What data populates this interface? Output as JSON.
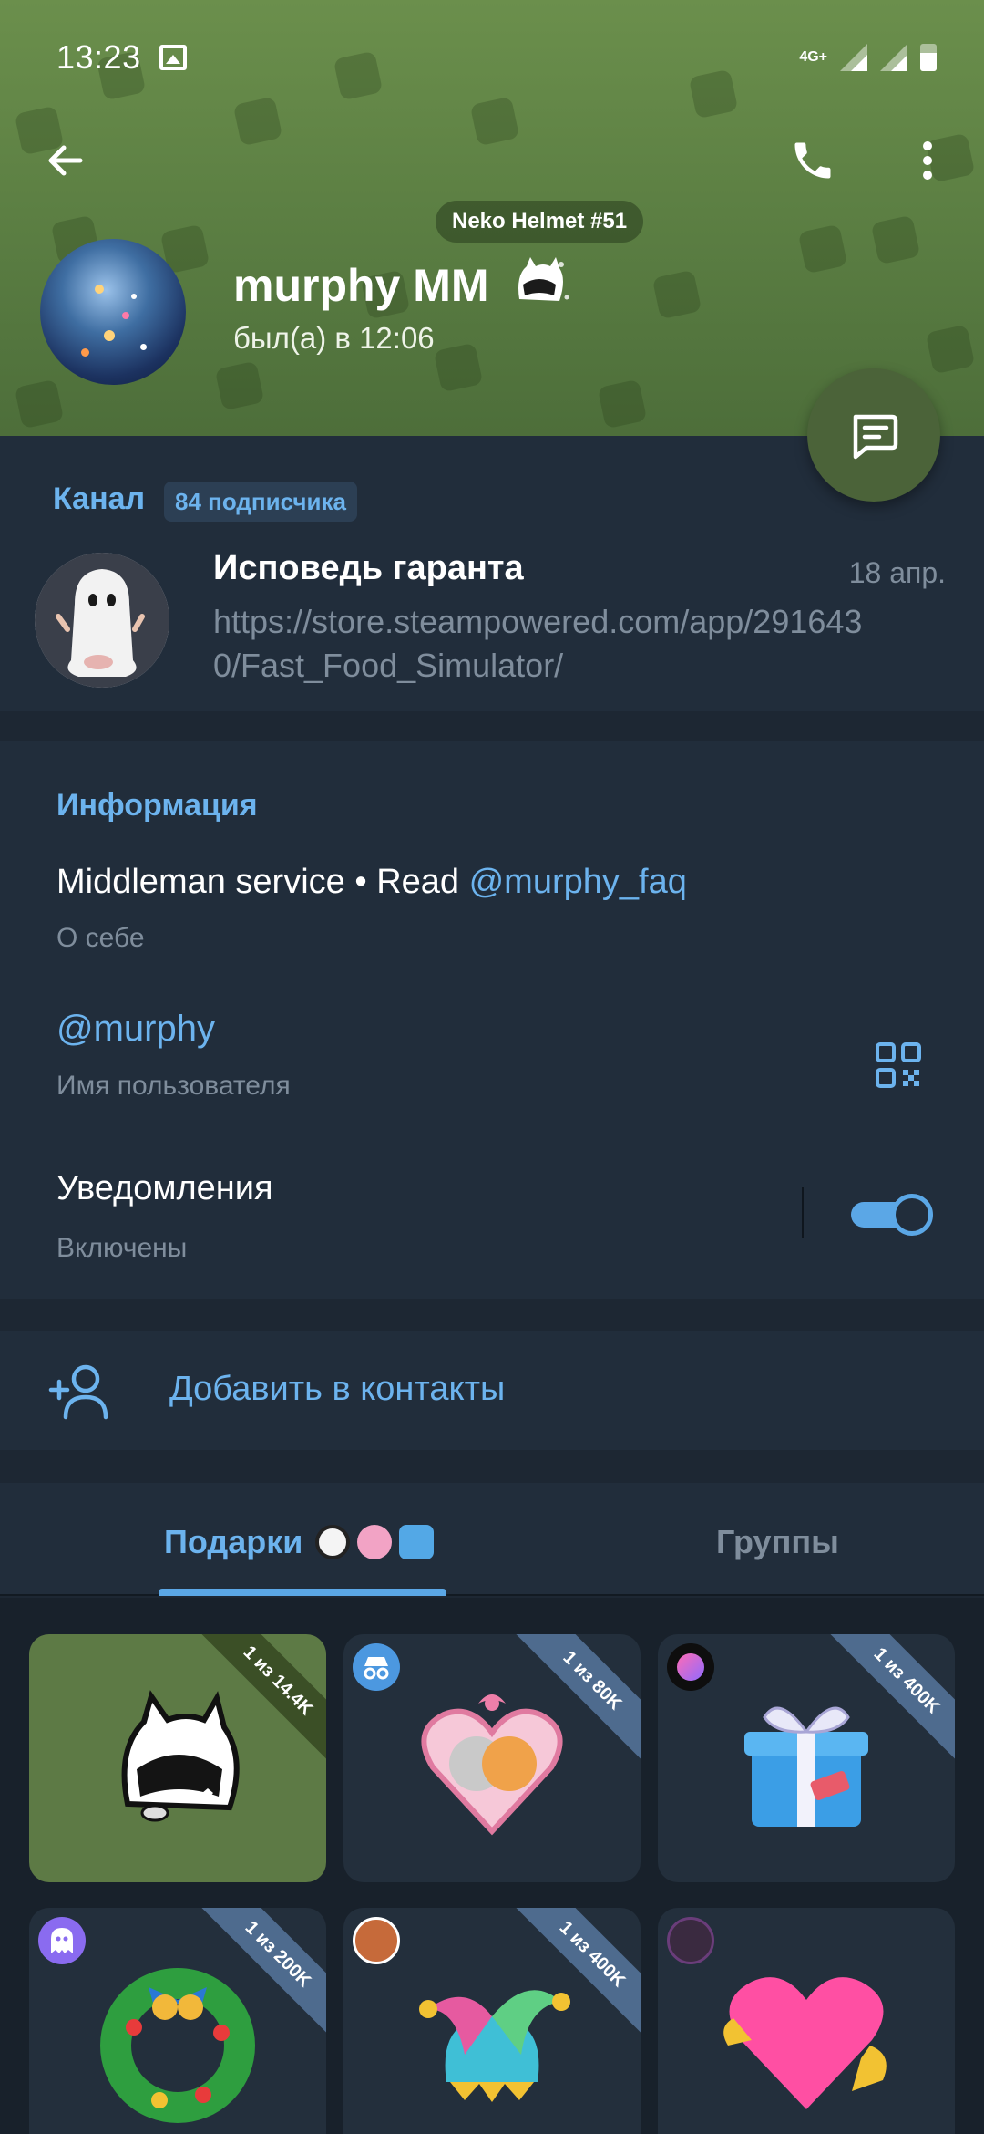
{
  "status_bar": {
    "time": "13:23",
    "network": "4G+"
  },
  "profile": {
    "collectible": "Neko Helmet #51",
    "name": "murphy MM",
    "last_seen": "был(а) в 12:06"
  },
  "channel": {
    "section_label": "Канал",
    "subscribers": "84 подписчика",
    "title": "Исповедь гаранта",
    "date": "18 апр.",
    "message": "https://store.steampowered.com/app/2916430/Fast_Food_Simulator/"
  },
  "info": {
    "heading": "Информация",
    "bio_text": "Middleman service • Read ",
    "bio_link": "@murphy_faq",
    "bio_label": "О себе",
    "username": "@murphy",
    "username_label": "Имя пользователя",
    "notifications_label": "Уведомления",
    "notifications_status": "Включены",
    "notifications_on": true
  },
  "add_contact": {
    "label": "Добавить в контакты"
  },
  "tabs": [
    {
      "label": "Подарки",
      "active": true
    },
    {
      "label": "Группы",
      "active": false
    }
  ],
  "gifts": [
    {
      "badge": "1 из 14.4K",
      "art": "neko-helmet",
      "owner_icon": ""
    },
    {
      "badge": "1 из 80K",
      "art": "heart-cats",
      "owner_icon": "incognito-icon"
    },
    {
      "badge": "1 из 400K",
      "art": "gift-box",
      "owner_icon": "orb-icon"
    },
    {
      "badge": "1 из 200K",
      "art": "wreath",
      "owner_icon": "ghost-icon"
    },
    {
      "badge": "1 из 400K",
      "art": "jester-hat",
      "owner_icon": "avatar"
    },
    {
      "badge": "",
      "art": "pink-heart",
      "owner_icon": "avatar"
    }
  ],
  "colors": {
    "accent": "#6cb3ee",
    "header_green": "#5a7d42",
    "background": "#1d2733",
    "card": "#212d3b",
    "muted_text": "#7f8d9c"
  }
}
